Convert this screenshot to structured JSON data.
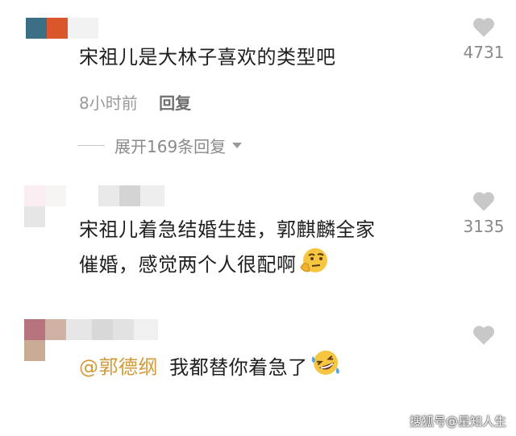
{
  "comments": [
    {
      "text": "宋祖儿是大林子喜欢的类型吧",
      "time": "8小时前",
      "reply_label": "回复",
      "likes": "4731",
      "expand_label": "展开169条回复"
    },
    {
      "text_line1": "宋祖儿着急结婚生娃，郭麒麟全家",
      "text_line2": "催婚，感觉两个人很配啊",
      "likes": "3135",
      "emoji": "thinking-face-emoji"
    },
    {
      "mention": "@郭德纲",
      "text": "我都替你着急了",
      "emoji": "rolling-on-floor-laughing-emoji"
    }
  ],
  "watermark": "搜狐号@星知人生",
  "colors": {
    "mention": "#d19a3a",
    "heart": "#c8c8c8"
  }
}
